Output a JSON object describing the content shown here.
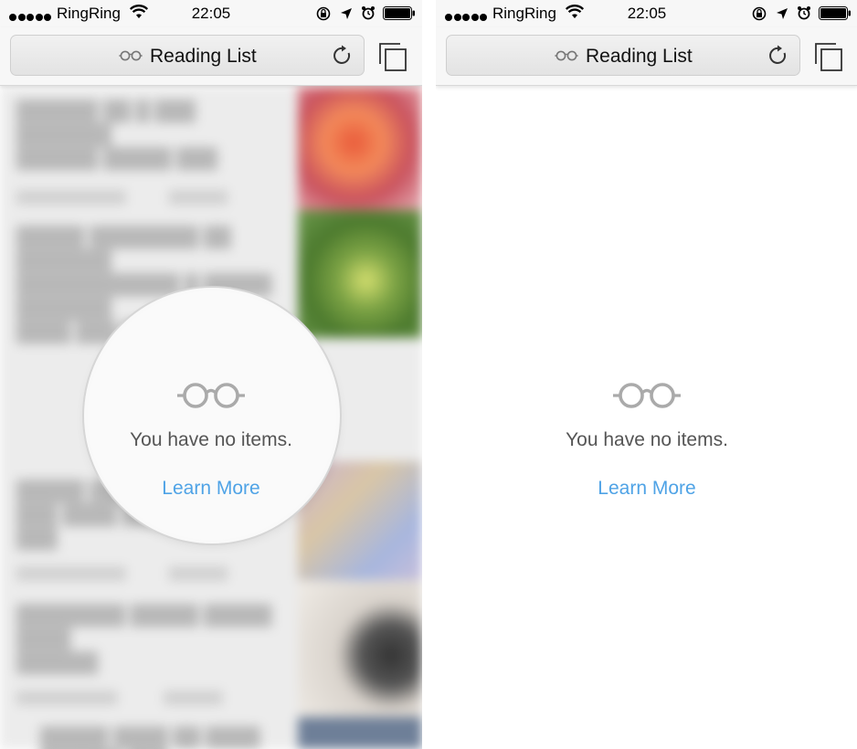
{
  "status_bar": {
    "carrier": "RingRing",
    "time": "22:05"
  },
  "nav": {
    "title": "Reading List"
  },
  "empty_state": {
    "message": "You have no items.",
    "link": "Learn More"
  },
  "colors": {
    "link_blue": "#4fa3e6",
    "bar_bg": "#f7f7f7"
  },
  "icons": [
    "signal-dots-icon",
    "wifi-icon",
    "orientation-lock-icon",
    "location-arrow-icon",
    "alarm-icon",
    "battery-icon",
    "glasses-icon",
    "reload-icon",
    "tabs-icon"
  ]
}
